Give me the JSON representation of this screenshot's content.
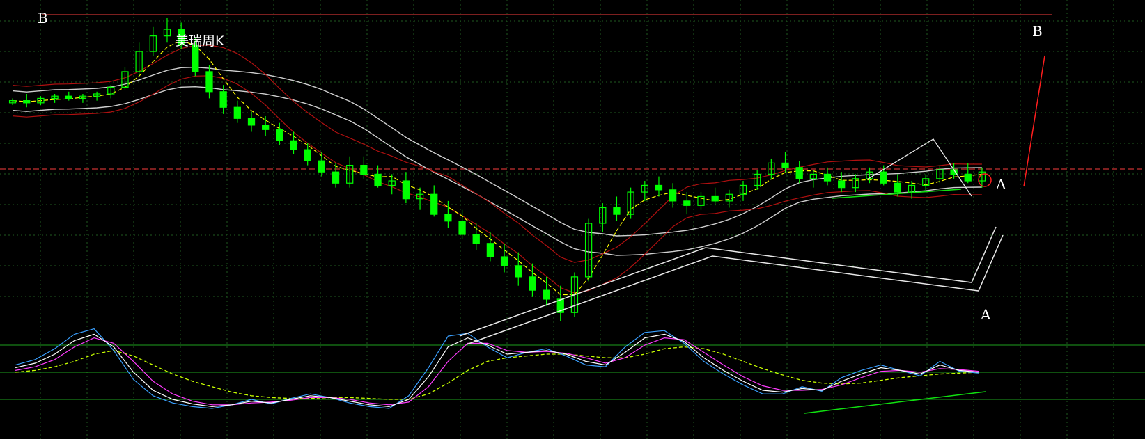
{
  "chart_data": {
    "type": "candlestick",
    "title": "美瑞周K",
    "grid": true,
    "wave_labels": {
      "top_left": "B",
      "top_right": "B",
      "right_upper": "A",
      "right_lower": "A"
    },
    "colors": {
      "background": "#000000",
      "grid": "#1f5a1f",
      "candle": "#00ff00",
      "ma_yellow": "#ffff00",
      "band_red": "#b01010",
      "band_white": "#cfcfcf",
      "ref_line": "#c83232",
      "osc_k": "#ffffff",
      "osc_d": "#ff3cff",
      "osc_j": "#3aa0ff",
      "osc_signal": "#c8ff00",
      "trend_green": "#10e010",
      "annot": "#e8e8e8",
      "projection": "#ff1e1e"
    },
    "candles": [
      [
        108,
        110,
        107,
        109
      ],
      [
        109,
        112,
        106,
        108
      ],
      [
        108,
        111,
        107,
        110
      ],
      [
        110,
        112,
        108,
        111
      ],
      [
        111,
        113,
        109,
        110
      ],
      [
        110,
        112,
        108,
        111
      ],
      [
        111,
        113,
        109,
        112
      ],
      [
        112,
        116,
        110,
        115
      ],
      [
        115,
        124,
        114,
        122
      ],
      [
        122,
        135,
        120,
        131
      ],
      [
        131,
        142,
        129,
        138
      ],
      [
        138,
        146,
        135,
        141
      ],
      [
        141,
        144,
        132,
        134
      ],
      [
        134,
        137,
        120,
        122
      ],
      [
        122,
        125,
        110,
        113
      ],
      [
        113,
        116,
        103,
        106
      ],
      [
        106,
        109,
        99,
        101
      ],
      [
        101,
        104,
        95,
        98
      ],
      [
        98,
        102,
        93,
        96
      ],
      [
        96,
        99,
        89,
        91
      ],
      [
        91,
        95,
        85,
        87
      ],
      [
        87,
        90,
        80,
        82
      ],
      [
        82,
        86,
        75,
        77
      ],
      [
        77,
        81,
        70,
        72
      ],
      [
        72,
        84,
        70,
        80
      ],
      [
        80,
        84,
        74,
        76
      ],
      [
        76,
        80,
        70,
        71
      ],
      [
        71,
        76,
        67,
        73
      ],
      [
        73,
        77,
        63,
        65
      ],
      [
        65,
        70,
        60,
        67
      ],
      [
        67,
        71,
        57,
        58
      ],
      [
        58,
        64,
        52,
        55
      ],
      [
        55,
        60,
        47,
        49
      ],
      [
        49,
        54,
        42,
        45
      ],
      [
        45,
        50,
        37,
        39
      ],
      [
        39,
        45,
        32,
        35
      ],
      [
        35,
        41,
        26,
        30
      ],
      [
        30,
        36,
        21,
        24
      ],
      [
        24,
        30,
        17,
        20
      ],
      [
        20,
        26,
        10,
        14
      ],
      [
        14,
        32,
        12,
        30
      ],
      [
        30,
        56,
        28,
        54
      ],
      [
        54,
        63,
        50,
        61
      ],
      [
        61,
        66,
        55,
        58
      ],
      [
        58,
        70,
        56,
        68
      ],
      [
        68,
        73,
        64,
        71
      ],
      [
        71,
        75,
        66,
        69
      ],
      [
        69,
        72,
        61,
        64
      ],
      [
        64,
        68,
        58,
        62
      ],
      [
        62,
        68,
        60,
        66
      ],
      [
        66,
        70,
        62,
        64
      ],
      [
        64,
        69,
        61,
        67
      ],
      [
        67,
        73,
        64,
        71
      ],
      [
        71,
        78,
        69,
        76
      ],
      [
        76,
        83,
        74,
        81
      ],
      [
        81,
        86,
        77,
        79
      ],
      [
        79,
        82,
        72,
        74
      ],
      [
        74,
        78,
        70,
        76
      ],
      [
        76,
        79,
        71,
        73
      ],
      [
        73,
        77,
        68,
        70
      ],
      [
        70,
        76,
        68,
        74
      ],
      [
        74,
        79,
        72,
        77
      ],
      [
        77,
        80,
        71,
        72
      ],
      [
        72,
        76,
        66,
        68
      ],
      [
        68,
        73,
        65,
        71
      ],
      [
        71,
        76,
        68,
        74
      ],
      [
        74,
        80,
        72,
        78
      ],
      [
        78,
        81,
        74,
        76
      ],
      [
        76,
        81,
        72,
        73
      ],
      [
        73,
        79,
        70,
        77
      ]
    ],
    "oscillator": {
      "levels": [
        80,
        50,
        20
      ],
      "k": [
        55,
        60,
        70,
        85,
        92,
        78,
        50,
        30,
        20,
        15,
        12,
        14,
        18,
        16,
        20,
        24,
        22,
        18,
        14,
        12,
        20,
        45,
        78,
        88,
        80,
        70,
        72,
        74,
        70,
        62,
        58,
        72,
        88,
        92,
        84,
        66,
        52,
        40,
        30,
        28,
        32,
        30,
        40,
        48,
        55,
        52,
        48,
        58,
        52,
        50
      ],
      "d": [
        52,
        56,
        64,
        78,
        88,
        82,
        62,
        40,
        26,
        18,
        14,
        14,
        16,
        17,
        19,
        22,
        22,
        20,
        16,
        14,
        17,
        34,
        62,
        82,
        82,
        74,
        72,
        73,
        71,
        66,
        60,
        66,
        80,
        88,
        86,
        72,
        58,
        45,
        35,
        30,
        30,
        31,
        36,
        44,
        51,
        52,
        50,
        54,
        53,
        51
      ],
      "j": [
        58,
        64,
        76,
        92,
        98,
        74,
        42,
        24,
        16,
        12,
        10,
        14,
        20,
        15,
        21,
        26,
        22,
        16,
        12,
        10,
        24,
        55,
        90,
        93,
        78,
        66,
        72,
        76,
        68,
        58,
        56,
        78,
        94,
        96,
        82,
        62,
        48,
        36,
        26,
        26,
        34,
        29,
        44,
        52,
        58,
        52,
        46,
        62,
        51,
        49
      ],
      "signal": [
        50,
        52,
        56,
        62,
        70,
        74,
        68,
        58,
        48,
        40,
        34,
        28,
        24,
        22,
        21,
        21,
        22,
        22,
        21,
        20,
        20,
        26,
        38,
        52,
        62,
        66,
        68,
        70,
        70,
        68,
        66,
        66,
        70,
        76,
        78,
        76,
        70,
        62,
        54,
        47,
        41,
        38,
        37,
        38,
        41,
        44,
        46,
        48,
        49,
        50
      ]
    }
  }
}
